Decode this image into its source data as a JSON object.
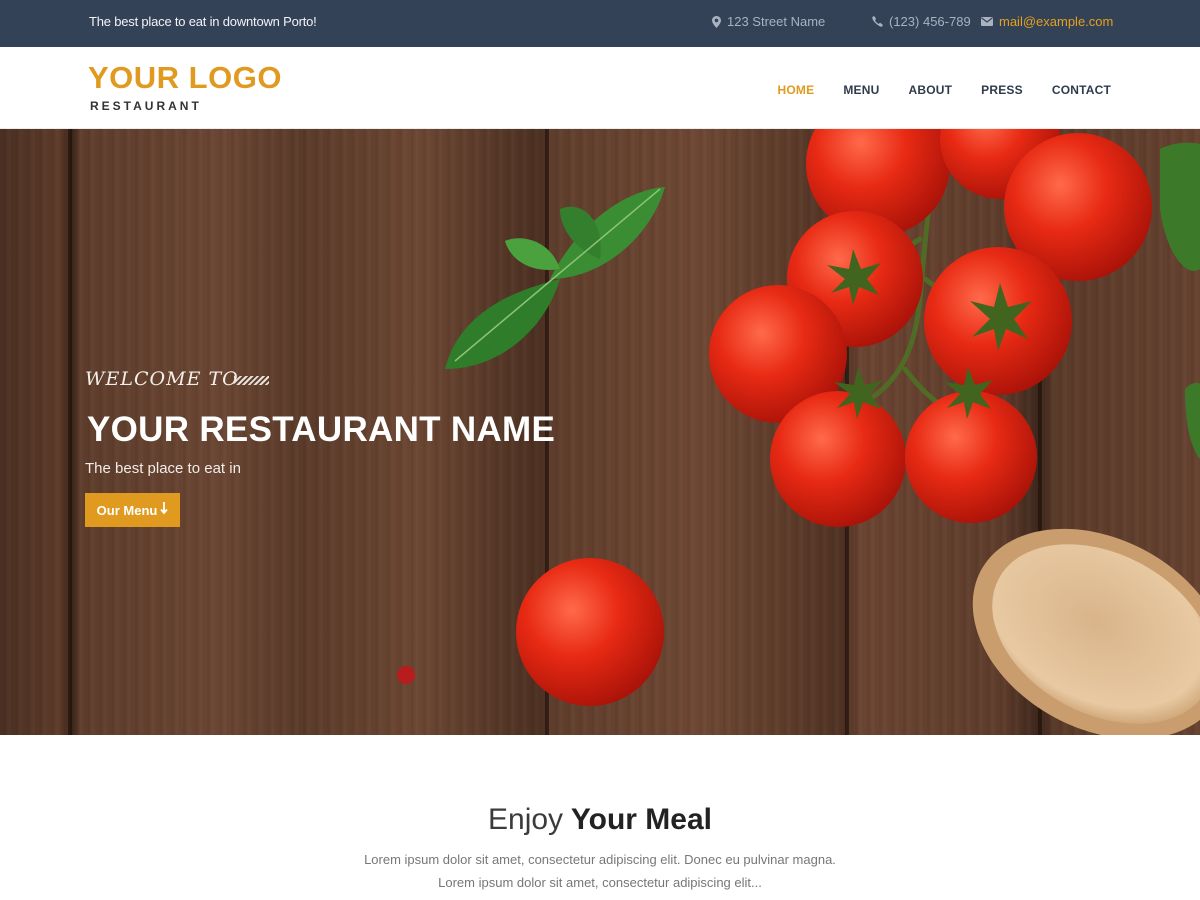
{
  "topbar": {
    "tagline": "The best place to eat in downtown Porto!",
    "address": "123 Street Name",
    "phone": "(123) 456-789",
    "email": "mail@example.com",
    "icons": [
      "map-marker-icon",
      "phone-icon",
      "envelope-icon"
    ]
  },
  "header": {
    "logo_title": "YOUR LOGO",
    "logo_subtitle": "RESTAURANT",
    "nav": [
      {
        "label": "HOME",
        "active": true
      },
      {
        "label": "MENU",
        "active": false
      },
      {
        "label": "ABOUT",
        "active": false
      },
      {
        "label": "PRESS",
        "active": false
      },
      {
        "label": "CONTACT",
        "active": false
      }
    ]
  },
  "hero": {
    "welcome": "WELCOME TO",
    "title": "YOUR RESTAURANT NAME",
    "subtitle": "The best place to eat in",
    "button_label": "Our Menu"
  },
  "section": {
    "title_light": "Enjoy",
    "title_bold": "Your Meal",
    "text_line1": "Lorem ipsum dolor sit amet, consectetur adipiscing elit. Donec eu pulvinar magna.",
    "text_line2": "Lorem ipsum dolor sit amet, consectetur adipiscing elit..."
  },
  "colors": {
    "accent": "#e09a1f",
    "topbar_bg": "#344258",
    "nav_text": "#2f3b4d"
  }
}
